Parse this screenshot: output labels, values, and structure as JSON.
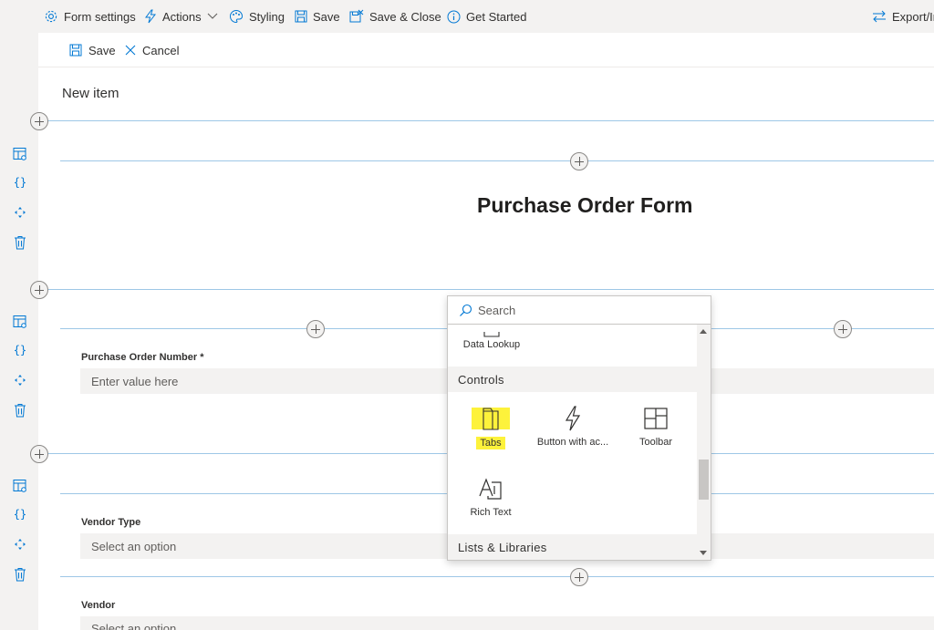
{
  "toolbar": {
    "form_settings": "Form settings",
    "actions": "Actions",
    "styling": "Styling",
    "save": "Save",
    "save_close": "Save & Close",
    "get_started": "Get Started",
    "export": "Export/In"
  },
  "commandbar": {
    "save": "Save",
    "cancel": "Cancel"
  },
  "page": {
    "title": "New item",
    "form_heading": "Purchase Order Form"
  },
  "fields": {
    "po_number": {
      "label": "Purchase Order Number *",
      "placeholder": "Enter value here"
    },
    "vendor_type": {
      "label": "Vendor Type",
      "placeholder": "Select an option"
    },
    "vendor": {
      "label": "Vendor",
      "placeholder": "Select an option"
    }
  },
  "picker": {
    "search_placeholder": "Search",
    "data_lookup": "Data Lookup",
    "category_controls": "Controls",
    "tiles": [
      "Tabs",
      "Button with ac...",
      "Toolbar",
      "Rich Text"
    ],
    "category_lists": "Lists & Libraries",
    "highlight_color": "#fdf23b"
  },
  "colors": {
    "accent": "#0078d4",
    "divider": "#9ec7e6"
  }
}
